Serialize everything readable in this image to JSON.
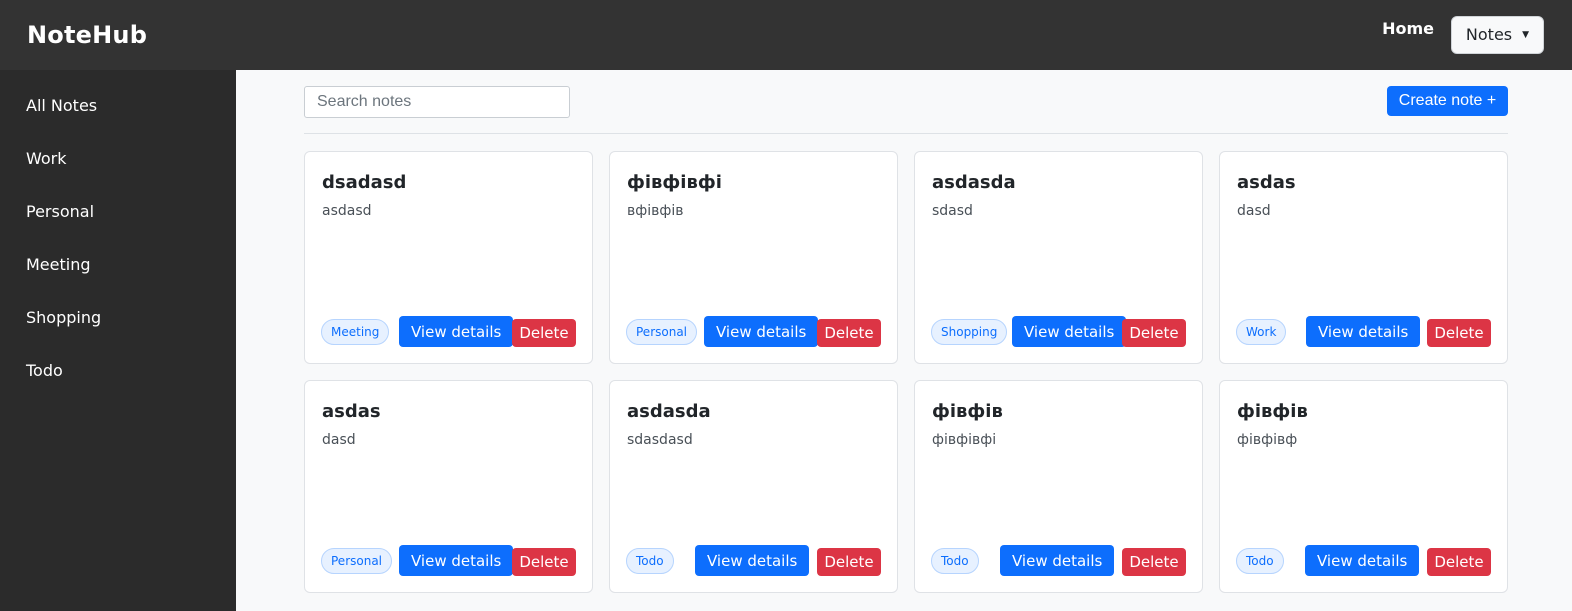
{
  "header": {
    "brand": "NoteHub",
    "home_label": "Home",
    "notes_menu_label": "Notes",
    "notes_menu_caret": "▼"
  },
  "sidebar": {
    "items": [
      {
        "label": "All Notes"
      },
      {
        "label": "Work"
      },
      {
        "label": "Personal"
      },
      {
        "label": "Meeting"
      },
      {
        "label": "Shopping"
      },
      {
        "label": "Todo"
      }
    ]
  },
  "toolbar": {
    "search_placeholder": "Search notes",
    "search_value": "",
    "create_label": "Create note +"
  },
  "cards": {
    "view_label": "View details",
    "delete_label": "Delete",
    "items": [
      {
        "title": "dsadasd",
        "content": "asdasd",
        "tag": "Meeting"
      },
      {
        "title": "фівфівфі",
        "content": "вфівфів",
        "tag": "Personal"
      },
      {
        "title": "asdasda",
        "content": "sdasd",
        "tag": "Shopping"
      },
      {
        "title": "asdas",
        "content": "dasd",
        "tag": "Work"
      },
      {
        "title": "asdas",
        "content": "dasd",
        "tag": "Personal"
      },
      {
        "title": "asdasda",
        "content": "sdasdasd",
        "tag": "Todo"
      },
      {
        "title": "фівфів",
        "content": "фівфівфі",
        "tag": "Todo"
      },
      {
        "title": "фівфів",
        "content": "фівфівф",
        "tag": "Todo"
      }
    ]
  },
  "colors": {
    "topbar": "#333333",
    "sidebar": "#2b2b2b",
    "primary": "#0d6efd",
    "danger": "#dc3545",
    "background": "#f8f9fa"
  }
}
